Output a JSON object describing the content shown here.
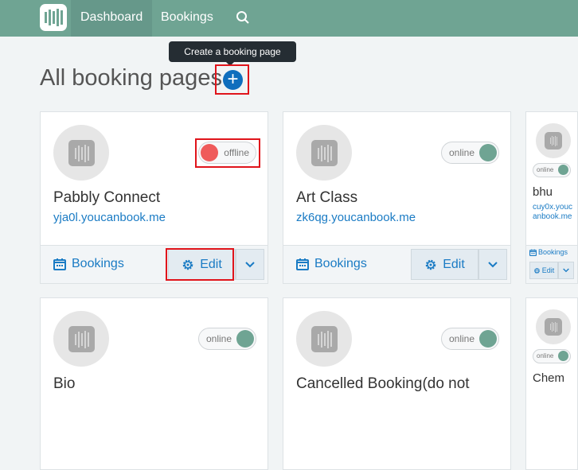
{
  "nav": {
    "items": [
      "Dashboard",
      "Bookings"
    ]
  },
  "tooltip": "Create a booking page",
  "page_title": "All booking pages",
  "accent": "#0f6ebd",
  "cards": [
    {
      "name": "Pabbly Connect",
      "url": "yja0l.youcanbook.me",
      "status": "offline",
      "bookings": "Bookings",
      "edit": "Edit"
    },
    {
      "name": "Art Class",
      "url": "zk6qg.youcanbook.me",
      "status": "online",
      "bookings": "Bookings",
      "edit": "Edit"
    },
    {
      "name": "bhu",
      "url": "cuy0x.youcanbook.me",
      "status": "online",
      "bookings": "Bookings",
      "edit": "Edit"
    },
    {
      "name": "Bio",
      "url": "",
      "status": "online"
    },
    {
      "name": "Cancelled Booking(do not",
      "url": "",
      "status": "online"
    },
    {
      "name": "Chem",
      "url": "",
      "status": "online"
    }
  ]
}
